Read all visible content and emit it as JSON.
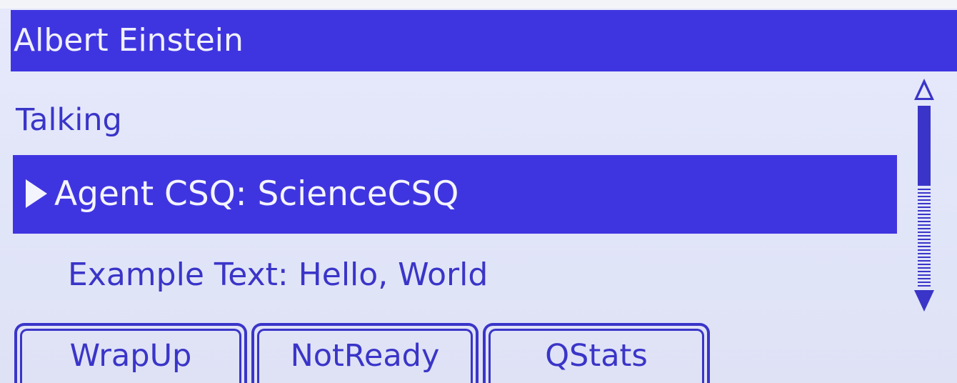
{
  "header": {
    "title": "Albert Einstein"
  },
  "status": {
    "text": "Talking"
  },
  "rows": {
    "selected_label": "Agent CSQ: ScienceCSQ",
    "plain_label": "Example Text: Hello, World"
  },
  "softkeys": {
    "wrapup": "WrapUp",
    "notready": "NotReady",
    "qstats": "QStats"
  },
  "colors": {
    "accent": "#3f35e0",
    "text": "#3a35c8",
    "background": "#e3e6f9"
  }
}
